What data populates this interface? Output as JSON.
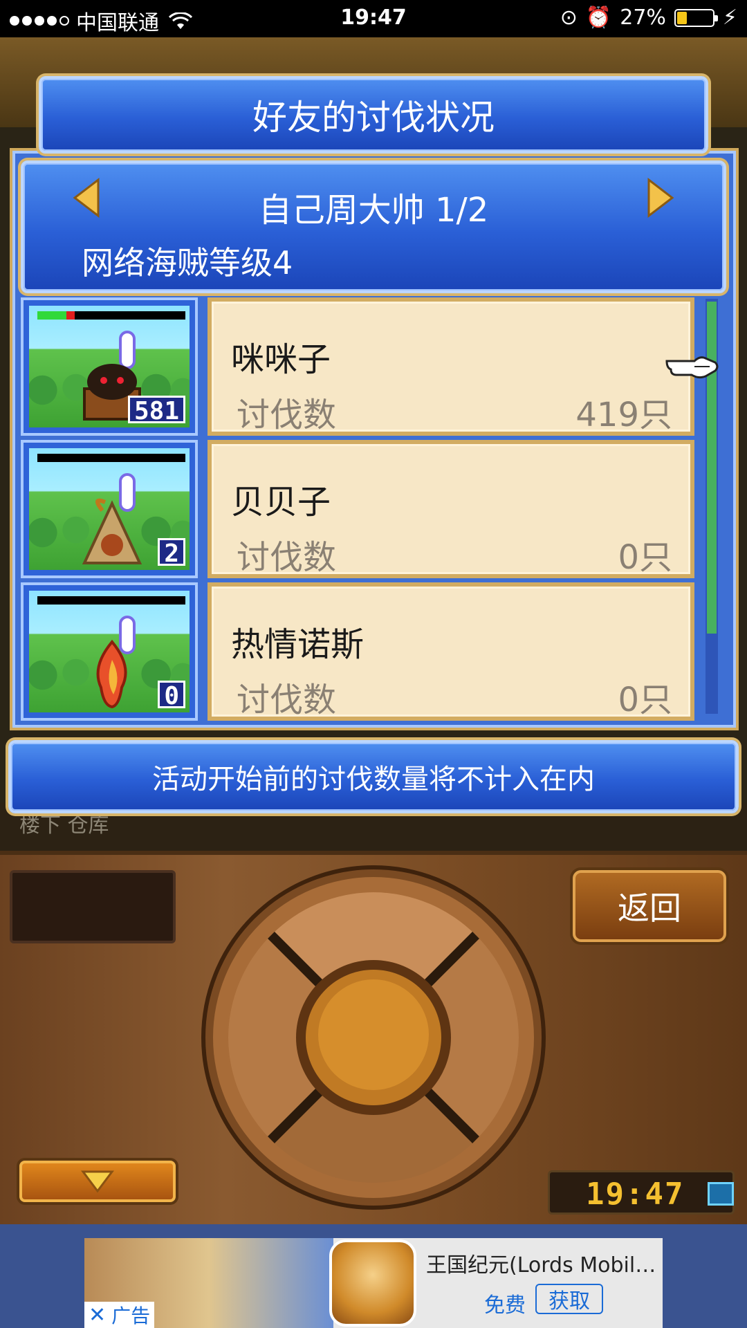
{
  "status_bar": {
    "carrier": "中国联通",
    "time": "19:47",
    "battery_percent": "27%",
    "battery_level": 0.27
  },
  "dialog": {
    "title": "好友的讨伐状况",
    "header_title": "自己周大帅 1/2",
    "header_sub": "网络海贼等级4",
    "rows": [
      {
        "name": "咪咪子",
        "kill_label": "讨伐数",
        "kill_value": "419只",
        "badge": "581",
        "hp_fraction": 0.2
      },
      {
        "name": "贝贝子",
        "kill_label": "讨伐数",
        "kill_value": "0只",
        "badge": "2",
        "hp_fraction": 0
      },
      {
        "name": "热情诺斯",
        "kill_label": "讨伐数",
        "kill_value": "0只",
        "badge": "0",
        "hp_fraction": 0
      }
    ],
    "notice": "活动开始前的讨伐数量将不计入在内"
  },
  "background": {
    "strip_text": "楼下 仓库"
  },
  "controls": {
    "back_label": "返回",
    "clock": "19:47"
  },
  "ad": {
    "title": "王国纪元(Lords Mobil…",
    "free_label": "免费",
    "get_label": "获取",
    "ad_label": "广告"
  },
  "colors": {
    "panel_blue": "#2a5fd6",
    "card_cream": "#f7e7c6",
    "gold_border": "#d2ac62"
  }
}
